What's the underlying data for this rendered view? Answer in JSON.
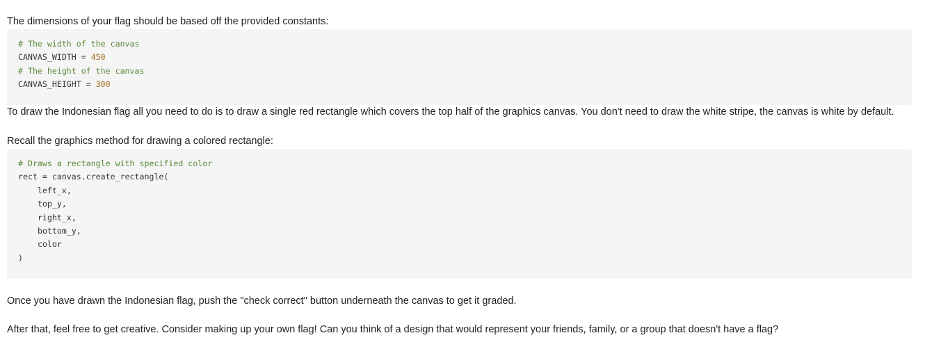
{
  "intro": "The dimensions of your flag should be based off the provided constants:",
  "code_constants": {
    "line1_comment": "# The width of the canvas",
    "line2_name": "CANVAS_WIDTH = ",
    "line2_value": "450",
    "line3_comment": "# The height of the canvas",
    "line4_name": "CANVAS_HEIGHT = ",
    "line4_value": "300"
  },
  "instructions": "To draw the Indonesian flag all you need to do is to draw a single red rectangle which covers the top half of the graphics canvas. You don't need to draw the white stripe, the canvas is white by default.",
  "recall": "Recall the graphics method for drawing a colored rectangle:",
  "code_method": {
    "comment": "# Draws a rectangle with specified color",
    "call": "rect = canvas.create_rectangle(",
    "args": [
      "left_x,",
      "top_y,",
      "right_x,",
      "bottom_y,",
      "color"
    ],
    "close": ")"
  },
  "push_button": "Once you have drawn the Indonesian flag, push the \"check correct\" button underneath the canvas to get it graded.",
  "after_that": "After that, feel free to get creative. Consider making up your own flag! Can you think of a design that would represent your friends, family, or a group that doesn't have a flag?"
}
